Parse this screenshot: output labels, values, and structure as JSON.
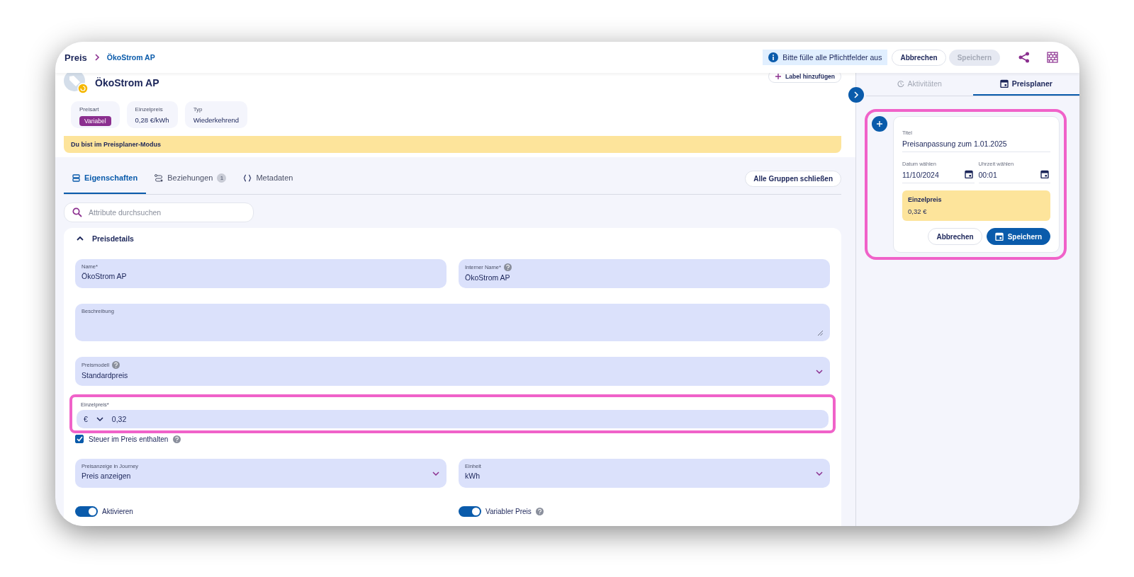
{
  "header": {
    "breadcrumb": [
      {
        "label": "Preis",
        "selected": false
      },
      {
        "label": "ÖkoStrom AP",
        "selected": true
      }
    ],
    "notice": "Bitte fülle alle Pflichtfelder aus",
    "buttons": [
      {
        "label": "Abbrechen",
        "kind": "secondary"
      },
      {
        "label": "Speichern",
        "kind": "primary",
        "disabled": true
      }
    ]
  },
  "entity": {
    "title": "ÖkoStrom AP",
    "add_label": "Label hinzufügen",
    "facts": [
      {
        "label": "Preisart",
        "value": "Variabel",
        "kind": "badge"
      },
      {
        "label": "Einzelpreis",
        "value": "0,28 €/kWh",
        "kind": "text"
      },
      {
        "label": "Typ",
        "value": "Wiederkehrend",
        "kind": "text"
      }
    ]
  },
  "banner": "Du bist im Preisplaner-Modus",
  "tabs": [
    {
      "label": "Eigenschaften",
      "selected": true
    },
    {
      "label": "Beziehungen",
      "count": "1",
      "selected": false
    },
    {
      "label": "Metadaten",
      "selected": false
    }
  ],
  "collapse_all": "Alle Gruppen schließen",
  "search": {
    "placeholder": "Attribute durchsuchen"
  },
  "section": {
    "title": "Preisdetails",
    "expanded": true,
    "rows": [
      [
        {
          "kind": "text",
          "label": "Name*",
          "value": "ÖkoStrom AP"
        },
        {
          "kind": "text",
          "label": "Interner Name*",
          "help": true,
          "value": "ÖkoStrom AP"
        }
      ],
      [
        {
          "kind": "textarea",
          "label": "Beschreibung"
        }
      ],
      [
        {
          "kind": "select",
          "label": "Preismodell",
          "help": true,
          "value": "Standardpreis"
        }
      ],
      [
        {
          "kind": "currency",
          "label": "Einzelpreis*",
          "currency": "€",
          "value": "0,32",
          "highlighted": true
        }
      ],
      [
        {
          "kind": "checkbox",
          "label": "Steuer im Preis enthalten",
          "help": true,
          "checked": true
        }
      ],
      [
        {
          "kind": "select",
          "label": "Preisanzeige in Journey",
          "value": "Preis anzeigen"
        },
        {
          "kind": "select",
          "label": "Einheit",
          "value": "kWh"
        }
      ],
      [
        {
          "kind": "toggle",
          "label": "Aktivieren",
          "on": true
        },
        {
          "kind": "toggle",
          "label": "Variabler Preis",
          "help": true,
          "on": true
        }
      ]
    ]
  },
  "panel": {
    "tabs": [
      {
        "label": "Aktivitäten",
        "selected": false
      },
      {
        "label": "Preisplaner",
        "selected": true
      }
    ],
    "planner": {
      "highlighted": true,
      "title": {
        "label": "Titel",
        "value": "Preisanpassung zum 1.01.2025"
      },
      "date": {
        "label": "Datum wählen",
        "value": "11/10/2024"
      },
      "time": {
        "label": "Uhrzeit wählen",
        "value": "00:01"
      },
      "price": {
        "label": "Einzelpreis",
        "value": "0,32 €"
      },
      "buttons": [
        {
          "label": "Abbrechen",
          "kind": "secondary"
        },
        {
          "label": "Speichern",
          "kind": "primary"
        }
      ]
    }
  }
}
